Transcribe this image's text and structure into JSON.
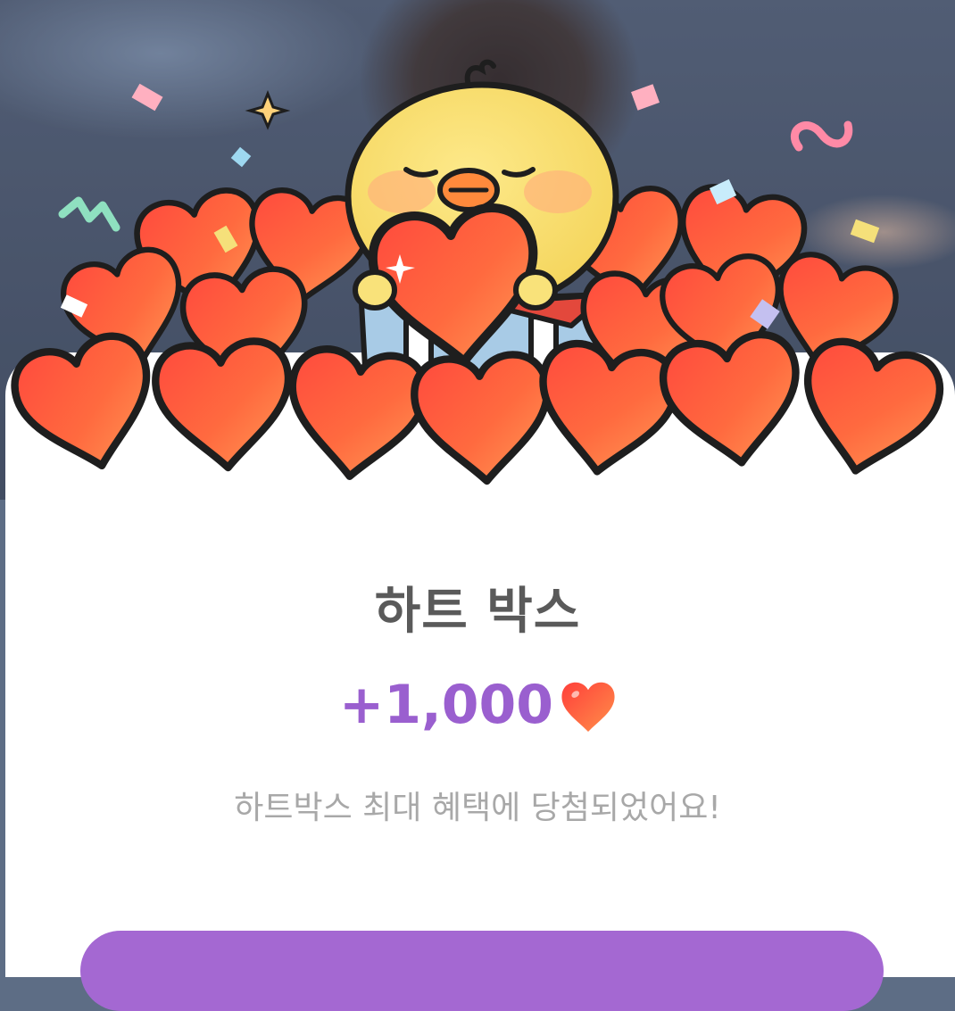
{
  "popup": {
    "title": "하트 박스",
    "reward_amount": "+1,000",
    "reward_icon": "heart-icon",
    "message": "하트박스 최대 혜택에 당첨되었어요!",
    "confirm_label": ""
  },
  "colors": {
    "accent_purple": "#a468d2",
    "amount_purple": "#9a5fcf",
    "heart_red": "#ff5a3c",
    "chick_yellow": "#f9e27a"
  }
}
